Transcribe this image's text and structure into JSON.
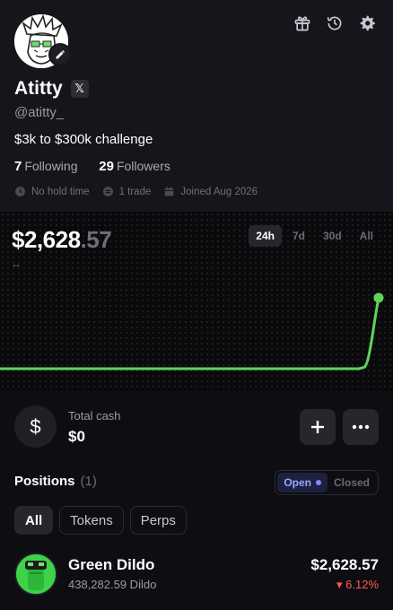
{
  "profile": {
    "name": "Atitty",
    "handle": "@atitty_",
    "bio": "$3k to $300k challenge",
    "following_count": "7",
    "following_label": "Following",
    "followers_count": "29",
    "followers_label": "Followers",
    "x_badge": "𝕏",
    "meta": {
      "hold_time": "No hold time",
      "trades": "1 trade",
      "joined": "Joined Aug 2026"
    }
  },
  "portfolio": {
    "balance_main": "$2,628",
    "balance_cents": ".57",
    "pnl": "--",
    "ranges": [
      "24h",
      "7d",
      "30d",
      "All"
    ],
    "active_range": "24h"
  },
  "chart_data": {
    "type": "line",
    "x_range": "24h",
    "series": [
      {
        "values": [
          0,
          0,
          0,
          0,
          0,
          0,
          0,
          0,
          0,
          0,
          0,
          0,
          0,
          0,
          0,
          0,
          0,
          0,
          0,
          0,
          0.02,
          1
        ]
      }
    ],
    "line_color": "#5ed45a",
    "grid": false
  },
  "cash": {
    "icon_glyph": "$",
    "label": "Total cash",
    "value": "$0",
    "add_glyph": "+",
    "more_glyph": "•••"
  },
  "positions": {
    "title": "Positions",
    "count": "(1)",
    "toggle_open": "Open",
    "toggle_closed": "Closed",
    "filters": [
      "All",
      "Tokens",
      "Perps"
    ],
    "items": [
      {
        "name": "Green Dildo",
        "amount": "438,282.59 Dildo",
        "value": "$2,628.57",
        "change": "▾ 6.12%"
      }
    ]
  },
  "colors": {
    "accent_green": "#5ed45a",
    "negative": "#ff5a4e",
    "toggle_blue": "#7f8cff"
  },
  "icons": [
    "gift-icon",
    "history-icon",
    "gear-icon",
    "pencil-icon",
    "x-logo-icon",
    "clock-icon",
    "trade-icon",
    "calendar-icon"
  ]
}
